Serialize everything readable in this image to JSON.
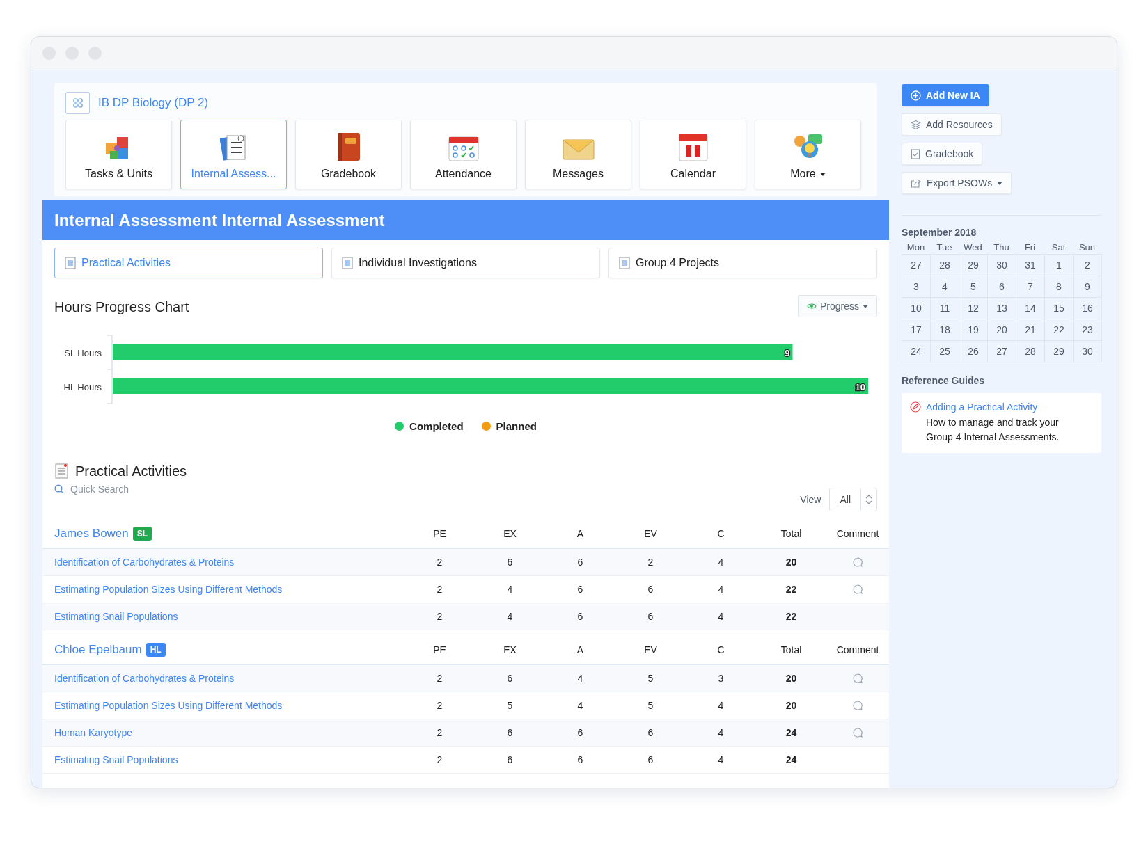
{
  "course": {
    "title": "IB DP Biology (DP 2)"
  },
  "nav_tiles": [
    {
      "label": "Tasks & Units",
      "selected": false,
      "kind": "puzzle",
      "dropdown": false
    },
    {
      "label": "Internal Assess...",
      "selected": true,
      "kind": "checklist",
      "dropdown": false
    },
    {
      "label": "Gradebook",
      "selected": false,
      "kind": "book",
      "dropdown": false
    },
    {
      "label": "Attendance",
      "selected": false,
      "kind": "attendance",
      "dropdown": false
    },
    {
      "label": "Messages",
      "selected": false,
      "kind": "envelope",
      "dropdown": false
    },
    {
      "label": "Calendar",
      "selected": false,
      "kind": "calendar",
      "dropdown": false
    },
    {
      "label": "More",
      "selected": false,
      "kind": "bulb",
      "dropdown": true
    }
  ],
  "banner": {
    "title": "Internal Assessment Internal Assessment"
  },
  "sub_tabs": [
    {
      "label": "Practical Activities",
      "selected": true
    },
    {
      "label": "Individual Investigations",
      "selected": false
    },
    {
      "label": "Group 4 Projects",
      "selected": false
    }
  ],
  "chart": {
    "title": "Hours Progress Chart",
    "view_button": "Progress",
    "chart_data": {
      "type": "bar",
      "orientation": "horizontal",
      "categories": [
        "SL Hours",
        "HL Hours"
      ],
      "xlim": [
        0,
        10
      ],
      "data_labels": true,
      "series": [
        {
          "name": "Completed",
          "color": "#22cc6b",
          "values": [
            9,
            10
          ]
        },
        {
          "name": "Planned",
          "color": "#f39c12",
          "values": [
            null,
            null
          ]
        }
      ]
    }
  },
  "activities": {
    "title": "Practical Activities",
    "search": {
      "placeholder": "Quick Search"
    },
    "view_label": "View",
    "view_value": "All",
    "students": [
      {
        "name": "James Bowen",
        "badge": "SL",
        "color": "#22a94f",
        "columns": [
          "PE",
          "EX",
          "A",
          "EV",
          "C",
          "Total",
          "Comment"
        ],
        "rows": [
          {
            "activity": "Identification of Carbohydrates & Proteins",
            "scores": [
              "2",
              "6",
              "6",
              "2",
              "4"
            ],
            "total": "20",
            "has_comment": true
          },
          {
            "activity": "Estimating Population Sizes Using Different Methods",
            "scores": [
              "2",
              "4",
              "6",
              "6",
              "4"
            ],
            "total": "22",
            "has_comment": true
          },
          {
            "activity": "Estimating Snail Populations",
            "scores": [
              "2",
              "4",
              "6",
              "6",
              "4"
            ],
            "total": "22",
            "has_comment": false
          }
        ]
      },
      {
        "name": "Chloe Epelbaum",
        "badge": "HL",
        "color": "#3d86f5",
        "columns": [
          "PE",
          "EX",
          "A",
          "EV",
          "C",
          "Total",
          "Comment"
        ],
        "rows": [
          {
            "activity": "Identification of Carbohydrates & Proteins",
            "scores": [
              "2",
              "6",
              "4",
              "5",
              "3"
            ],
            "total": "20",
            "has_comment": true
          },
          {
            "activity": "Estimating Population Sizes Using Different Methods",
            "scores": [
              "2",
              "5",
              "4",
              "5",
              "4"
            ],
            "total": "20",
            "has_comment": true
          },
          {
            "activity": "Human Karyotype",
            "scores": [
              "2",
              "6",
              "6",
              "6",
              "4"
            ],
            "total": "24",
            "has_comment": true
          },
          {
            "activity": "Estimating Snail Populations",
            "scores": [
              "2",
              "6",
              "6",
              "6",
              "4"
            ],
            "total": "24",
            "has_comment": false
          }
        ]
      }
    ]
  },
  "sidebar": {
    "buttons": [
      {
        "label": "Add New IA",
        "kind": "primary",
        "dropdown": false
      },
      {
        "label": "Add Resources",
        "kind": "layers",
        "dropdown": false
      },
      {
        "label": "Gradebook",
        "kind": "book",
        "dropdown": false
      },
      {
        "label": "Export PSOWs",
        "kind": "export",
        "dropdown": true
      }
    ],
    "calendar": {
      "month": "September 2018",
      "weekdays": [
        "Mon",
        "Tue",
        "Wed",
        "Thu",
        "Fri",
        "Sat",
        "Sun"
      ],
      "weeks": [
        [
          "27",
          "28",
          "29",
          "30",
          "31",
          "1",
          "2"
        ],
        [
          "3",
          "4",
          "5",
          "6",
          "7",
          "8",
          "9"
        ],
        [
          "10",
          "11",
          "12",
          "13",
          "14",
          "15",
          "16"
        ],
        [
          "17",
          "18",
          "19",
          "20",
          "21",
          "22",
          "23"
        ],
        [
          "24",
          "25",
          "26",
          "27",
          "28",
          "29",
          "30"
        ]
      ]
    },
    "reference_guides": {
      "title": "Reference Guides",
      "items": [
        {
          "link": "Adding a Practical Activity",
          "description": "How to manage and track your Group 4 Internal Assessments."
        }
      ]
    }
  }
}
